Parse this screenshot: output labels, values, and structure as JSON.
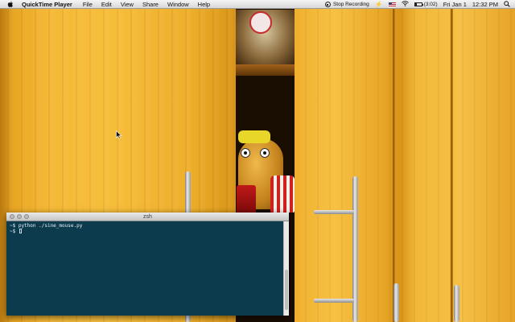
{
  "menubar": {
    "apple_icon": "apple-icon",
    "app_name": "QuickTime Player",
    "menus": [
      "File",
      "Edit",
      "View",
      "Share",
      "Window",
      "Help"
    ],
    "stop_recording_label": "Stop Recording",
    "input_source_icon": "us-flag-icon",
    "battery_text": "(3:02)",
    "date": "Fri Jan 1",
    "time": "12:32 PM",
    "status_icons": [
      "stop-recording-icon",
      "bolt-icon",
      "wifi-icon",
      "battery-icon",
      "search-icon"
    ]
  },
  "terminal": {
    "title": "zsh",
    "lines": [
      "~$ python ./sine_mouse.py",
      "~$ "
    ]
  }
}
